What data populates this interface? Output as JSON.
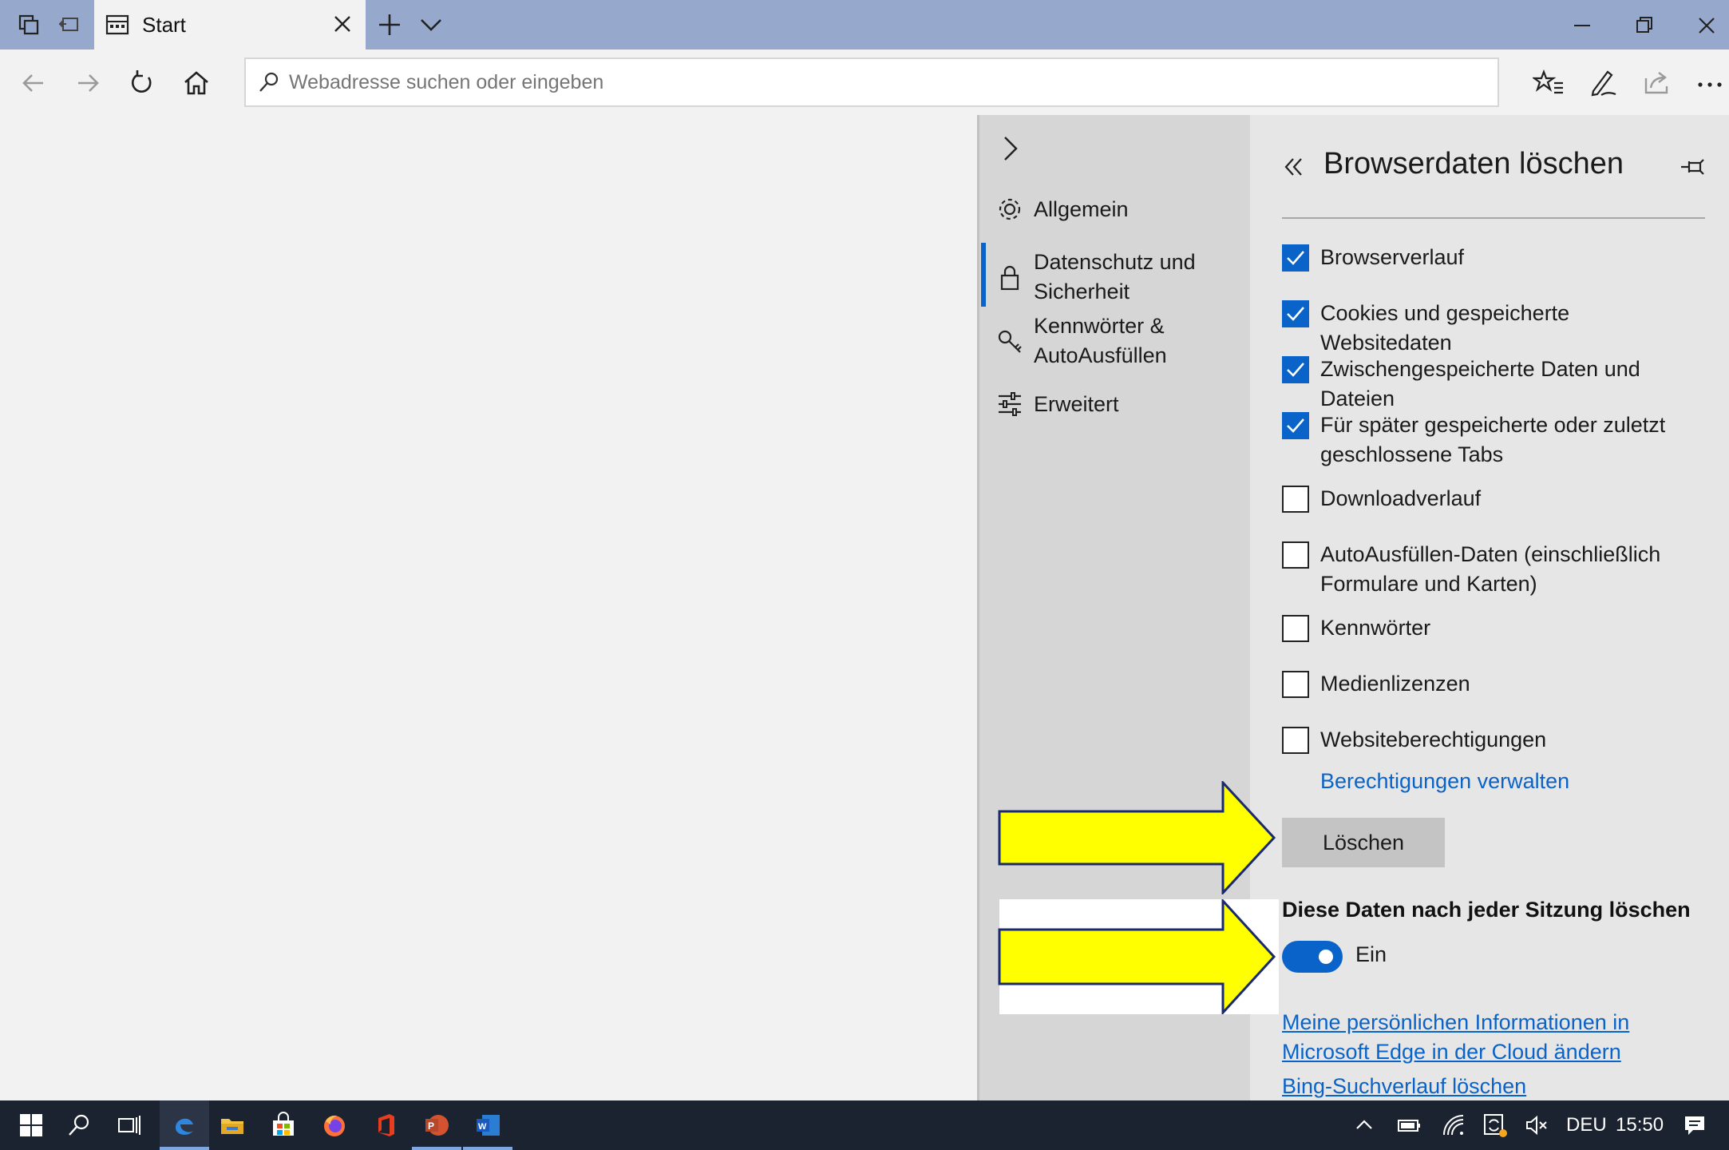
{
  "tab": {
    "title": "Start"
  },
  "address_bar": {
    "placeholder": "Webadresse suchen oder eingeben"
  },
  "nav_pane": {
    "items": [
      {
        "label": "Allgemein",
        "icon": "gear-icon"
      },
      {
        "label": "Datenschutz und Sicherheit",
        "icon": "lock-icon",
        "active": true
      },
      {
        "label": "Kennwörter & AutoAusfüllen",
        "icon": "key-icon"
      },
      {
        "label": "Erweitert",
        "icon": "sliders-icon"
      }
    ]
  },
  "panel": {
    "title": "Browserdaten löschen",
    "checkboxes": [
      {
        "label": "Browserverlauf",
        "checked": true
      },
      {
        "label": "Cookies und gespeicherte Websitedaten",
        "checked": true
      },
      {
        "label": "Zwischengespeicherte Daten und Dateien",
        "checked": true
      },
      {
        "label": "Für später gespeicherte oder zuletzt geschlossene Tabs",
        "checked": true
      },
      {
        "label": "Downloadverlauf",
        "checked": false
      },
      {
        "label": "AutoAusfüllen-Daten (einschließlich Formulare und Karten)",
        "checked": false
      },
      {
        "label": "Kennwörter",
        "checked": false
      },
      {
        "label": "Medienlizenzen",
        "checked": false
      },
      {
        "label": "Websiteberechtigungen",
        "checked": false
      }
    ],
    "manage_permissions_link": "Berechtigungen verwalten",
    "clear_button": "Löschen",
    "session_heading": "Diese Daten nach jeder Sitzung löschen",
    "toggle": {
      "state_label": "Ein",
      "on": true
    },
    "cloud_link": "Meine persönlichen Informationen in Microsoft Edge in der Cloud ändern",
    "bing_link": "Bing-Suchverlauf löschen"
  },
  "taskbar": {
    "language": "DEU",
    "time": "15:50"
  },
  "colors": {
    "accent": "#0a63c9",
    "titlebar": "#96a9cc",
    "arrow": "#ffff00"
  }
}
